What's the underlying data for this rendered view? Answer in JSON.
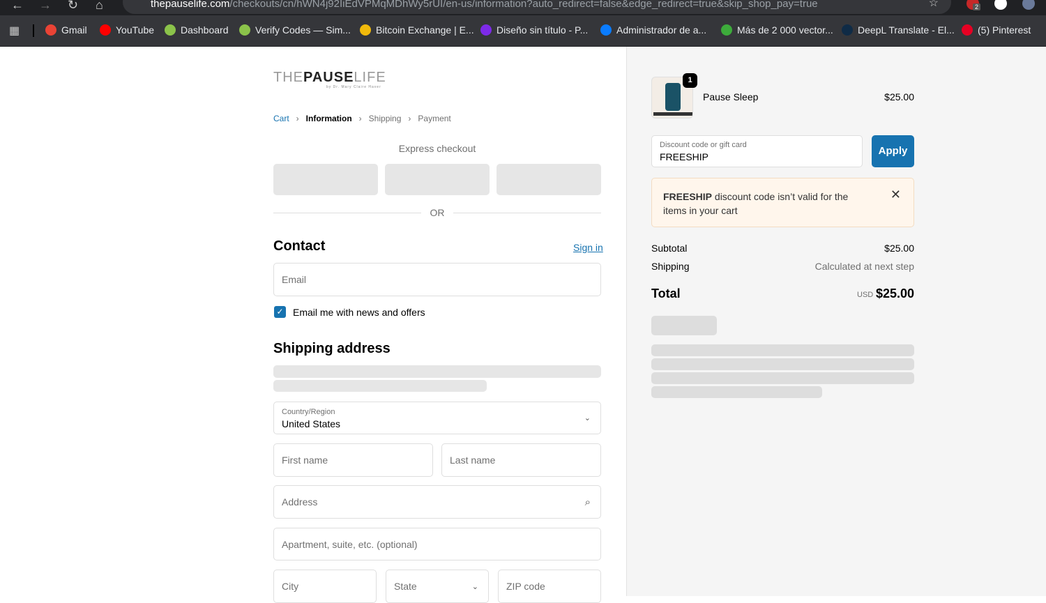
{
  "browser": {
    "url_domain": "thepauselife.com",
    "url_path": "/checkouts/cn/hWN4j92IiEdVPMqMDhWy5rUI/en-us/information?auto_redirect=false&edge_redirect=true&skip_shop_pay=true",
    "ext_badge": "2",
    "bookmarks": [
      {
        "label": "Gmail",
        "icon": "gmail-icon",
        "color": "#ea4335"
      },
      {
        "label": "YouTube",
        "icon": "youtube-icon",
        "color": "#ff0000"
      },
      {
        "label": "Dashboard",
        "icon": "dashboard-icon",
        "color": "#8bc34a"
      },
      {
        "label": "Verify Codes — Sim...",
        "icon": "verify-icon",
        "color": "#8bc34a"
      },
      {
        "label": "Bitcoin Exchange | E...",
        "icon": "binance-icon",
        "color": "#f0b90b"
      },
      {
        "label": "Diseño sin título - P...",
        "icon": "canva-icon",
        "color": "#7d2ae8"
      },
      {
        "label": "Administrador de a...",
        "icon": "meta-icon",
        "color": "#0a7cff"
      },
      {
        "label": "Más de 2 000 vector...",
        "icon": "px-icon",
        "color": "#3dab3b"
      },
      {
        "label": "DeepL Translate - El...",
        "icon": "deepl-icon",
        "color": "#0f2b46"
      },
      {
        "label": "(5) Pinterest",
        "icon": "pinterest-icon",
        "color": "#e60023"
      }
    ]
  },
  "logo": {
    "text_a": "THE",
    "text_b": "PAUSE",
    "text_c": "LIFE",
    "tagline": "by Dr. Mary Claire Haver"
  },
  "breadcrumb": {
    "cart": "Cart",
    "information": "Information",
    "shipping": "Shipping",
    "payment": "Payment"
  },
  "express": {
    "title": "Express checkout",
    "or": "OR"
  },
  "contact": {
    "title": "Contact",
    "sign_in": "Sign in",
    "email_placeholder": "Email",
    "newsletter": "Email me with news and offers"
  },
  "shipping": {
    "title": "Shipping address",
    "country_label": "Country/Region",
    "country_value": "United States",
    "first_name": "First name",
    "last_name": "Last name",
    "address": "Address",
    "apartment": "Apartment, suite, etc. (optional)",
    "city": "City",
    "state": "State",
    "zip": "ZIP code"
  },
  "summary": {
    "product_name": "Pause Sleep",
    "product_qty": "1",
    "product_price": "$25.00",
    "discount_label": "Discount code or gift card",
    "discount_value": "FREESHIP",
    "apply": "Apply",
    "error_code": "FREESHIP",
    "error_text": " discount code isn’t valid for the items in your cart",
    "subtotal_label": "Subtotal",
    "subtotal": "$25.00",
    "shipping_label": "Shipping",
    "shipping_value": "Calculated at next step",
    "total_label": "Total",
    "currency": "USD",
    "total": "$25.00"
  }
}
